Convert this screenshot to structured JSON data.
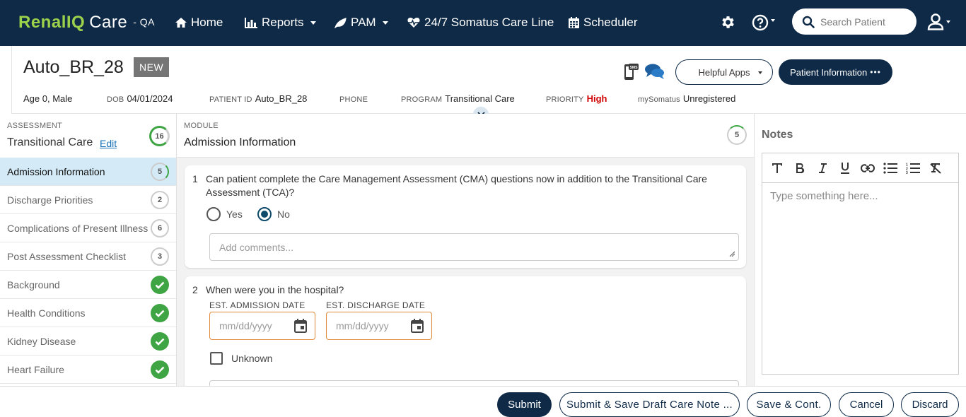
{
  "nav": {
    "brand_renal": "Renal",
    "brand_iq": "IQ",
    "brand_care": "Care",
    "env": "- QA",
    "items": [
      {
        "label": "Home",
        "icon": "home-icon"
      },
      {
        "label": "Reports",
        "icon": "bar-chart-icon"
      },
      {
        "label": "PAM",
        "icon": "leaf-icon"
      },
      {
        "label": "24/7 Somatus Care Line",
        "icon": "heartbeat-icon"
      },
      {
        "label": "Scheduler",
        "icon": "calendar-icon"
      }
    ],
    "search_placeholder": "Search Patient"
  },
  "patient": {
    "name": "Auto_BR_28",
    "badge": "NEW",
    "age_sex": "Age 0, Male",
    "dob_label": "DOB",
    "dob": "04/01/2024",
    "id_label": "PATIENT ID",
    "id": "Auto_BR_28",
    "phone_label": "PHONE",
    "phone": "",
    "program_label": "PROGRAM",
    "program": "Transitional Care",
    "priority_label": "PRIORITY",
    "priority": "High",
    "mysomatus_label": "mySomatus",
    "mysomatus": "Unregistered",
    "helpful_apps": "Helpful Apps",
    "patient_info": "Patient Information",
    "patient_info_more": "•••"
  },
  "assessment": {
    "section_label": "ASSESSMENT",
    "title": "Transitional Care",
    "edit": "Edit",
    "count": "16",
    "items": [
      {
        "label": "Admission Information",
        "count": "5",
        "done": false,
        "active": true
      },
      {
        "label": "Discharge Priorities",
        "count": "2",
        "done": false,
        "active": false
      },
      {
        "label": "Complications of Present Illness",
        "count": "6",
        "done": false,
        "active": false
      },
      {
        "label": "Post Assessment Checklist",
        "count": "3",
        "done": false,
        "active": false
      },
      {
        "label": "Background",
        "count": "",
        "done": true,
        "active": false
      },
      {
        "label": "Health Conditions",
        "count": "",
        "done": true,
        "active": false
      },
      {
        "label": "Kidney Disease",
        "count": "",
        "done": true,
        "active": false
      },
      {
        "label": "Heart Failure",
        "count": "",
        "done": true,
        "active": false
      }
    ]
  },
  "module": {
    "section_label": "MODULE",
    "title": "Admission Information",
    "count": "5",
    "q1": {
      "num": "1",
      "text": "Can patient complete the Care Management Assessment (CMA) questions now in addition to the Transitional Care Assessment (TCA)?",
      "opt_yes": "Yes",
      "opt_no": "No",
      "comment_placeholder": "Add comments..."
    },
    "q2": {
      "num": "2",
      "text": "When were you in the hospital?",
      "admission_label": "EST. ADMISSION DATE",
      "discharge_label": "EST. DISCHARGE DATE",
      "date_placeholder": "mm/dd/yyyy",
      "unknown_label": "Unknown"
    }
  },
  "notes": {
    "title": "Notes",
    "placeholder": "Type something here..."
  },
  "footer": {
    "submit": "Submit",
    "submit_draft": "Submit & Save Draft Care Note ...",
    "save_cont": "Save & Cont.",
    "cancel": "Cancel",
    "discard": "Discard"
  }
}
